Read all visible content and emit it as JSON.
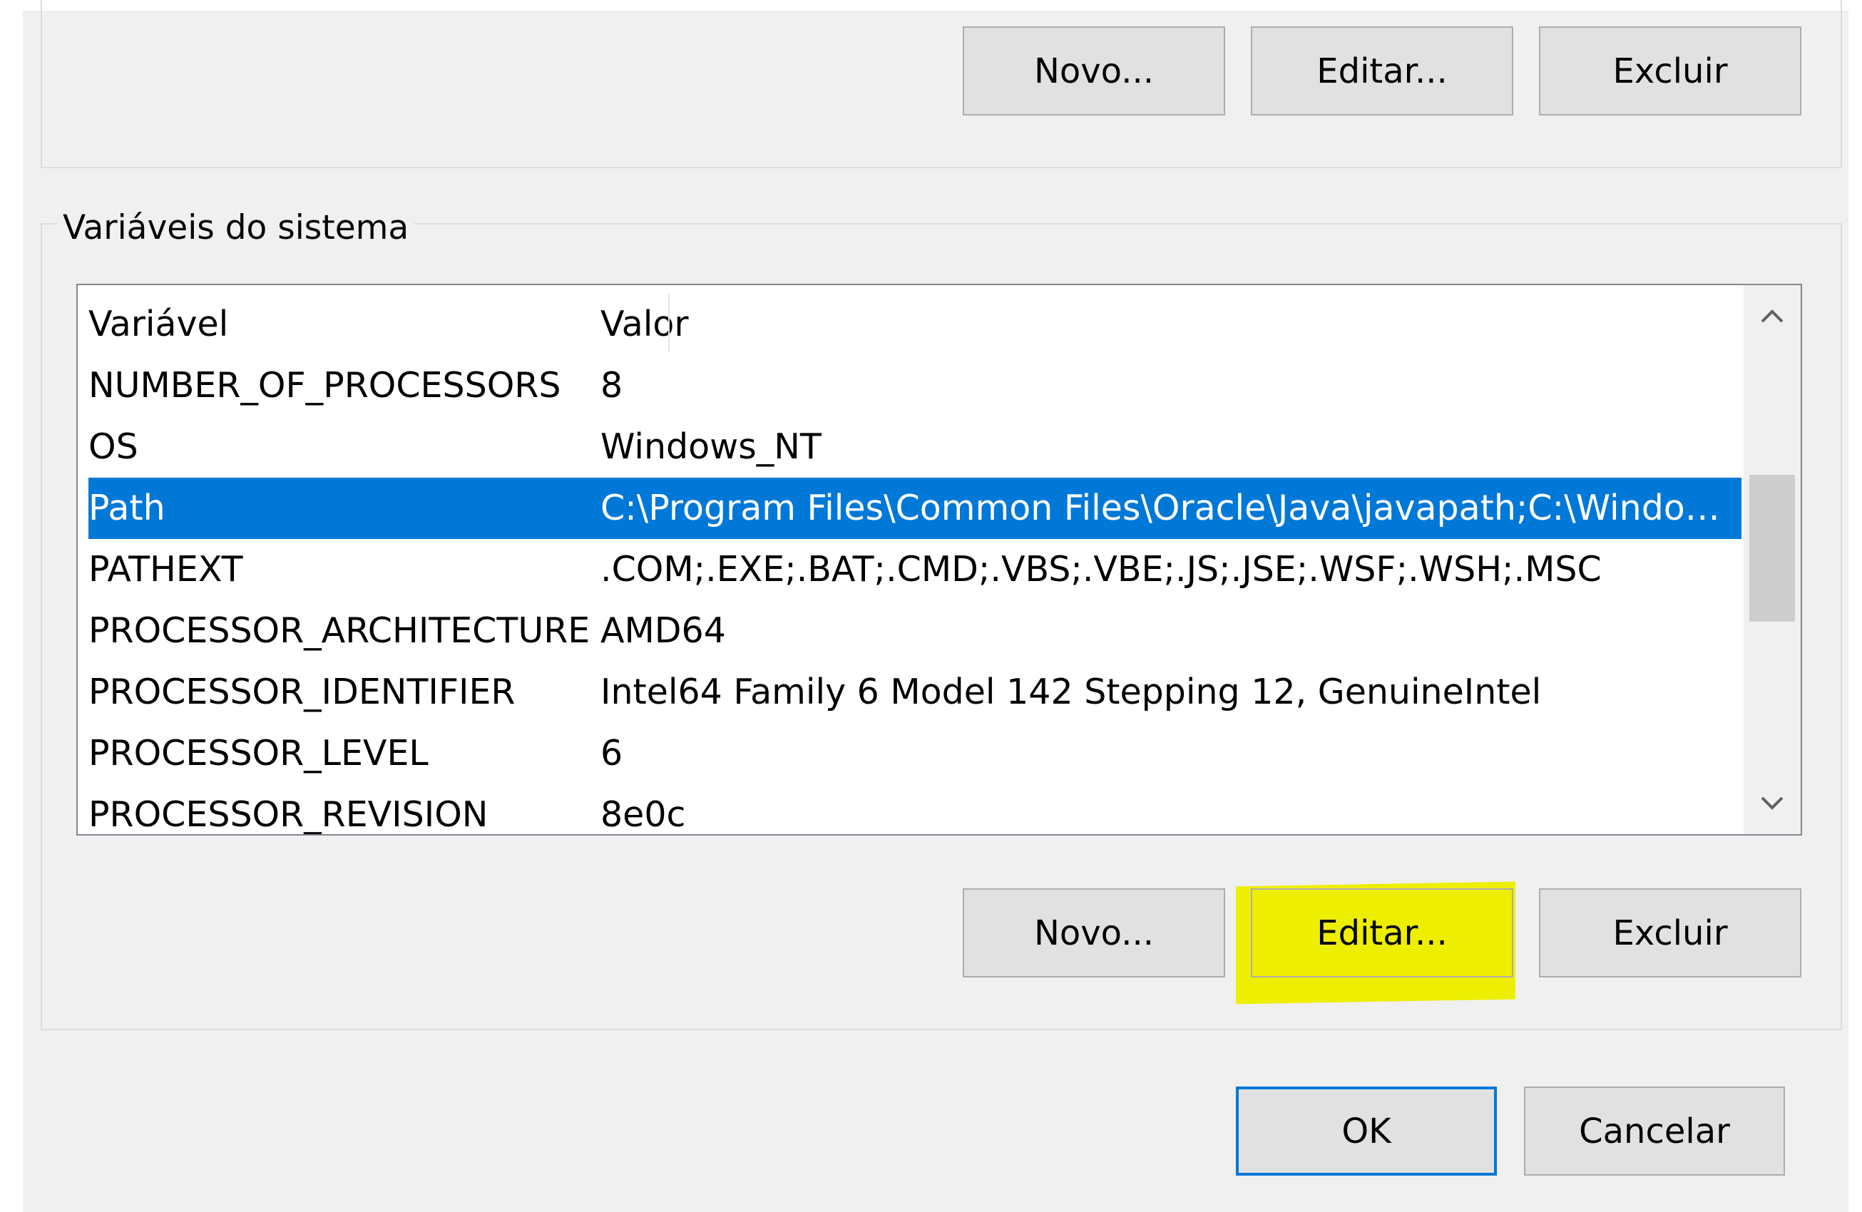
{
  "user_buttons": {
    "new": "Novo...",
    "edit": "Editar...",
    "delete": "Excluir"
  },
  "system_group": {
    "title": "Variáveis do sistema",
    "columns": {
      "variable": "Variável",
      "value": "Valor"
    },
    "rows": [
      {
        "name": "NUMBER_OF_PROCESSORS",
        "value": "8"
      },
      {
        "name": "OS",
        "value": "Windows_NT"
      },
      {
        "name": "Path",
        "value": "C:\\Program Files\\Common Files\\Oracle\\Java\\javapath;C:\\Window...",
        "selected": true
      },
      {
        "name": "PATHEXT",
        "value": ".COM;.EXE;.BAT;.CMD;.VBS;.VBE;.JS;.JSE;.WSF;.WSH;.MSC"
      },
      {
        "name": "PROCESSOR_ARCHITECTURE",
        "value": "AMD64"
      },
      {
        "name": "PROCESSOR_IDENTIFIER",
        "value": "Intel64 Family 6 Model 142 Stepping 12, GenuineIntel"
      },
      {
        "name": "PROCESSOR_LEVEL",
        "value": "6"
      },
      {
        "name": "PROCESSOR_REVISION",
        "value": "8e0c"
      }
    ],
    "buttons": {
      "new": "Novo...",
      "edit": "Editar...",
      "delete": "Excluir"
    }
  },
  "footer": {
    "ok": "OK",
    "cancel": "Cancelar"
  },
  "colors": {
    "selection": "#0078d7",
    "highlight": "#eeee00",
    "dialog_bg": "#f0f0f0"
  }
}
